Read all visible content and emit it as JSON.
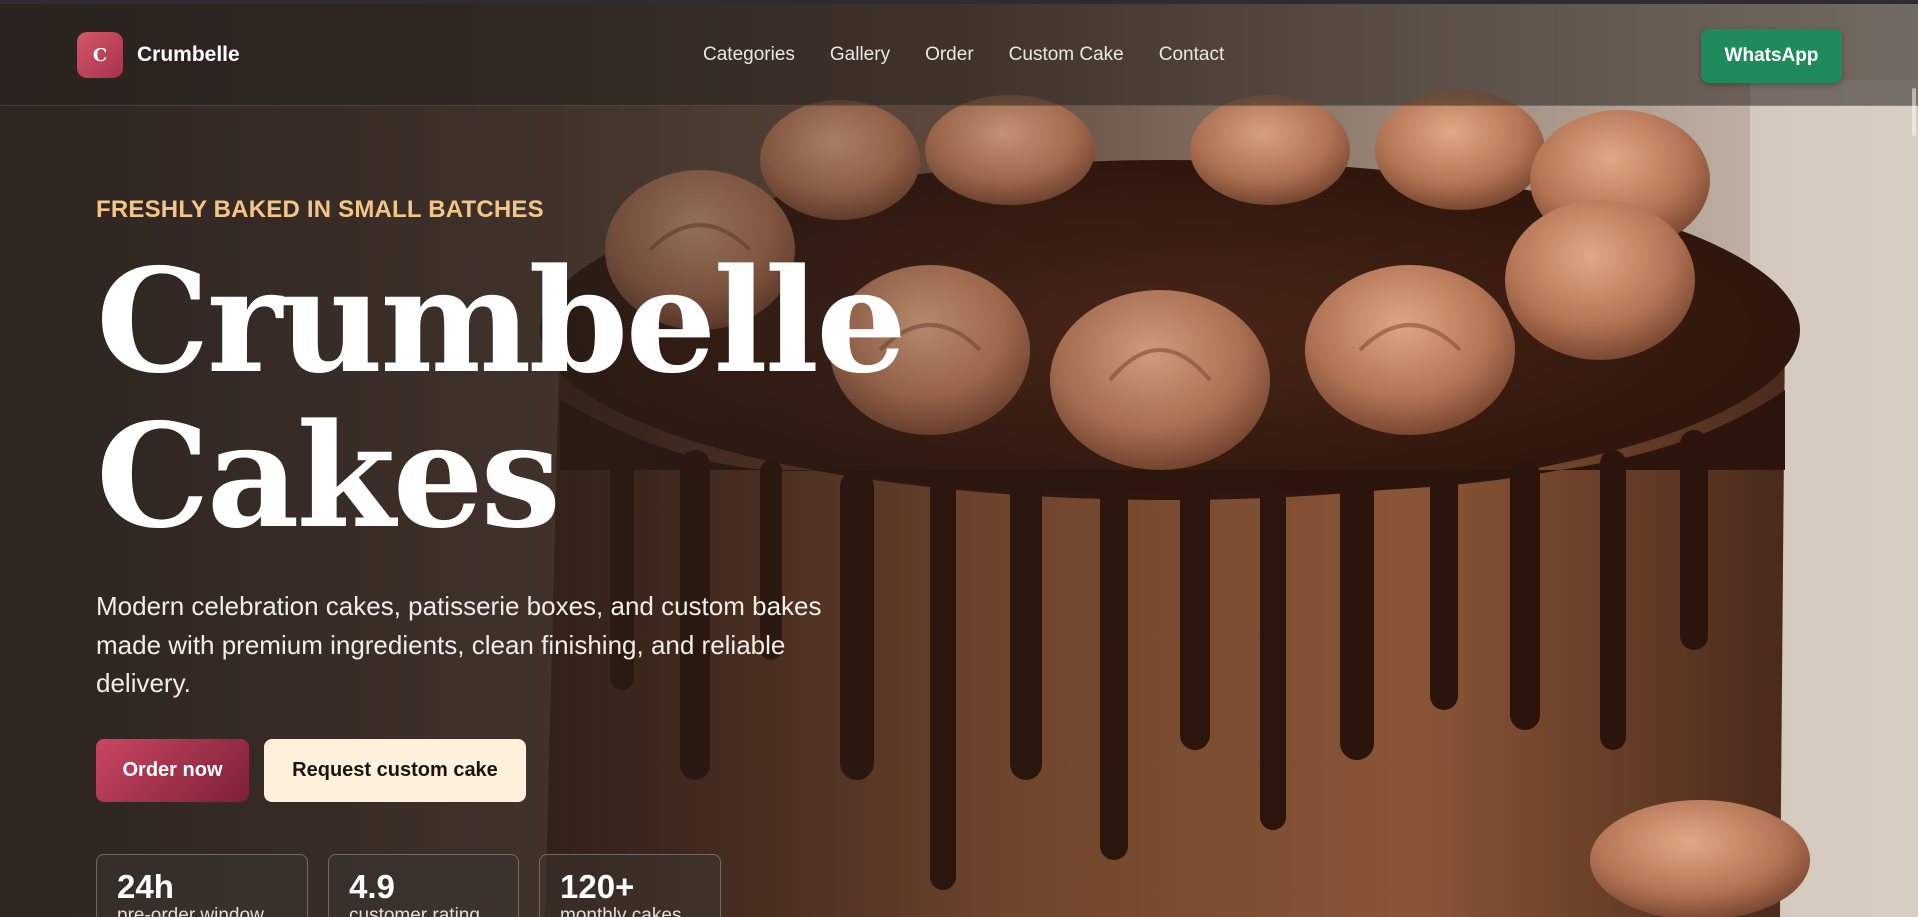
{
  "nav": {
    "brand_initial": "C",
    "brand_name": "Crumbelle",
    "links": [
      "Categories",
      "Gallery",
      "Order",
      "Custom Cake",
      "Contact"
    ],
    "cta": "WhatsApp",
    "cta_color": "#1f8a5c"
  },
  "hero": {
    "eyebrow": "FRESHLY BAKED IN SMALL BATCHES",
    "title_line1": "Crumbelle",
    "title_line2": "Cakes",
    "lede": "Modern celebration cakes, patisserie boxes, and custom bakes made with premium ingredients, clean finishing, and reliable delivery.",
    "primary_button": "Order now",
    "secondary_button": "Request custom cake",
    "background_image": "chocolate-drip-cake-photo"
  },
  "stats": [
    {
      "value": "24h",
      "label": "pre-order window"
    },
    {
      "value": "4.9",
      "label": "customer rating"
    },
    {
      "value": "120+",
      "label": "monthly cakes"
    }
  ],
  "colors": {
    "eyebrow": "#f4c588",
    "brand_accent": "#c94660",
    "secondary_button": "#fdf1dc"
  }
}
